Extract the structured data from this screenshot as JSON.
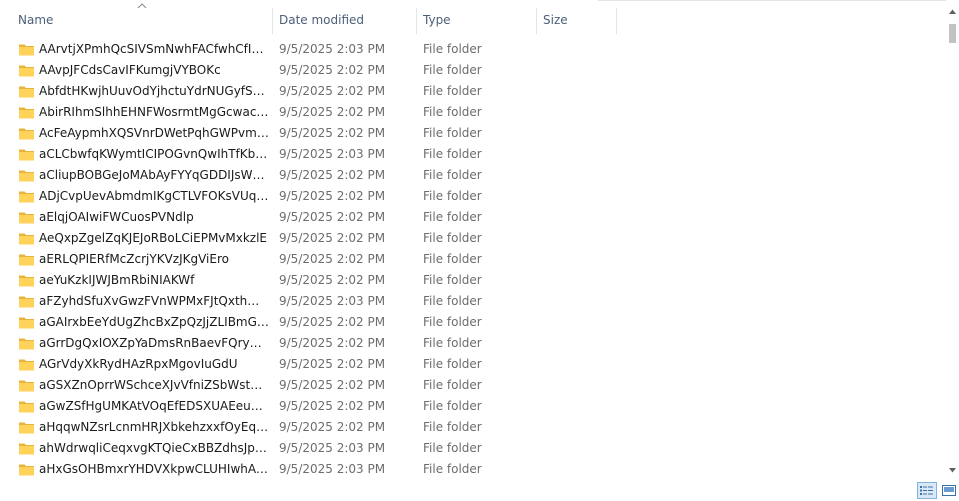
{
  "columns": {
    "name": "Name",
    "date": "Date modified",
    "type": "Type",
    "size": "Size"
  },
  "sort": {
    "column": "name",
    "direction": "ascending",
    "icon": "sort-up-icon"
  },
  "files": [
    {
      "name": "AArvtjXPmhQcSIVSmNwhFACfwhCfISQA...",
      "date": "9/5/2025 2:03 PM",
      "type": "File folder"
    },
    {
      "name": "AAvpJFCdsCavIFKumgjVYBOKc",
      "date": "9/5/2025 2:02 PM",
      "type": "File folder"
    },
    {
      "name": "AbfdtHKwjhUuvOdYjhctuYdrNUGyfSWM...",
      "date": "9/5/2025 2:02 PM",
      "type": "File folder"
    },
    {
      "name": "AbirRIhmSlhhEHNFWosrmtMgGcwacojhG",
      "date": "9/5/2025 2:02 PM",
      "type": "File folder"
    },
    {
      "name": "AcFeAypmhXQSVnrDWetPqhGWPvmVh...",
      "date": "9/5/2025 2:02 PM",
      "type": "File folder"
    },
    {
      "name": "aCLCbwfqKWymtICIPOGvnQwIhTfKbOh...",
      "date": "9/5/2025 2:03 PM",
      "type": "File folder"
    },
    {
      "name": "aCliupBOBGeJoMAbAyFYYqGDDIJsWggD...",
      "date": "9/5/2025 2:02 PM",
      "type": "File folder"
    },
    {
      "name": "ADjCvpUevAbmdmIKgCTLVFOKsVUqrqt...",
      "date": "9/5/2025 2:02 PM",
      "type": "File folder"
    },
    {
      "name": "aElqjOAIwiFWCuosPVNdlp",
      "date": "9/5/2025 2:02 PM",
      "type": "File folder"
    },
    {
      "name": "AeQxpZgelZqKJEJoRBoLCiEPMvMxkzlE",
      "date": "9/5/2025 2:02 PM",
      "type": "File folder"
    },
    {
      "name": "aERLQPIERfMcZcrjYKVzJKgViEro",
      "date": "9/5/2025 2:02 PM",
      "type": "File folder"
    },
    {
      "name": "aeYuKzkIJWJBmRbiNIAKWf",
      "date": "9/5/2025 2:02 PM",
      "type": "File folder"
    },
    {
      "name": "aFZyhdSfuXvGwzFVnWPMxFJtQxthMLEb...",
      "date": "9/5/2025 2:03 PM",
      "type": "File folder"
    },
    {
      "name": "aGAIrxbEeYdUgZhcBxZpQzJjZLIBmGuHY...",
      "date": "9/5/2025 2:02 PM",
      "type": "File folder"
    },
    {
      "name": "aGrrDgQxIOXZpYaDmsRnBaevFQryEIWIo...",
      "date": "9/5/2025 2:02 PM",
      "type": "File folder"
    },
    {
      "name": "AGrVdyXkRydHAzRpxMgovIuGdU",
      "date": "9/5/2025 2:02 PM",
      "type": "File folder"
    },
    {
      "name": "aGSXZnOprrWSchceXJvVfniZSbWstVFkq...",
      "date": "9/5/2025 2:02 PM",
      "type": "File folder"
    },
    {
      "name": "aGwZSfHgUMKAtVOqEfEDSXUAEeuRtqN...",
      "date": "9/5/2025 2:02 PM",
      "type": "File folder"
    },
    {
      "name": "aHqqwNZsrLcnmHRJXbkehzxxfOyEqkHV...",
      "date": "9/5/2025 2:02 PM",
      "type": "File folder"
    },
    {
      "name": "ahWdrwqliCeqxvgKTQieCxBBZdhsJpakK...",
      "date": "9/5/2025 2:03 PM",
      "type": "File folder"
    },
    {
      "name": "aHxGsOHBmxrYHDVXkpwCLUHIwhAQyI...",
      "date": "9/5/2025 2:03 PM",
      "type": "File folder"
    }
  ],
  "icons": {
    "folder": "folder-icon",
    "details_view": "details-view-icon",
    "tiles_view": "large-icons-view-icon"
  },
  "colors": {
    "header_text": "#4c607a",
    "folder": "#ffd25a",
    "folder_dark": "#e8b33a",
    "selected_view": "#dbe9f7"
  }
}
